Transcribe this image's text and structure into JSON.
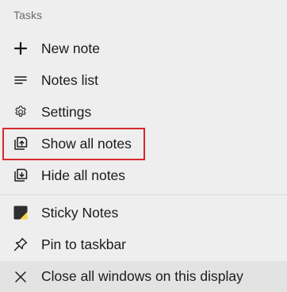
{
  "section": {
    "title": "Tasks"
  },
  "items": [
    {
      "label": "New note",
      "icon": "plus-icon"
    },
    {
      "label": "Notes list",
      "icon": "list-icon"
    },
    {
      "label": "Settings",
      "icon": "gear-icon"
    },
    {
      "label": "Show all notes",
      "icon": "show-notes-icon",
      "highlighted": true
    },
    {
      "label": "Hide all notes",
      "icon": "hide-notes-icon"
    }
  ],
  "app_items": [
    {
      "label": "Sticky Notes",
      "icon": "sticky-notes-app-icon"
    },
    {
      "label": "Pin to taskbar",
      "icon": "pin-icon"
    },
    {
      "label": "Close all windows on this display",
      "icon": "close-icon",
      "hovered": true
    }
  ],
  "colors": {
    "background": "#eeeeee",
    "highlight_border": "#d6282f",
    "hover_background": "#e3e3e3",
    "sticky_yellow": "#f6d743",
    "sticky_dark": "#2e2e2e"
  }
}
